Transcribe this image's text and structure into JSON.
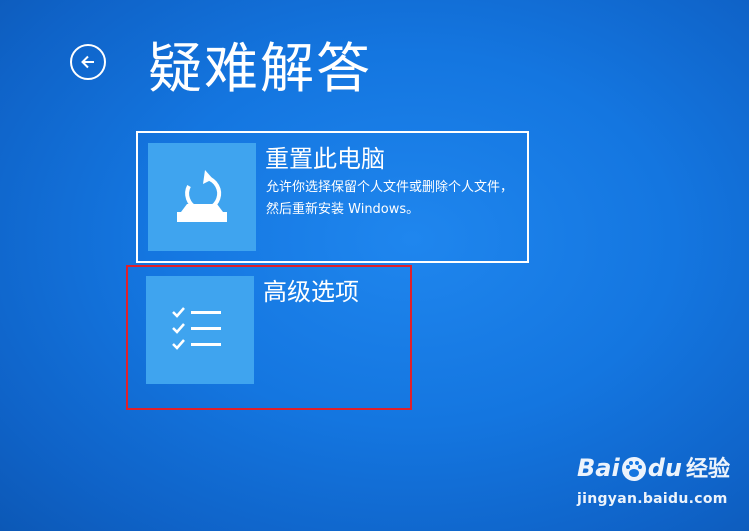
{
  "header": {
    "title": "疑难解答",
    "back_icon": "back-arrow-icon"
  },
  "options": [
    {
      "title": "重置此电脑",
      "description": "允许你选择保留个人文件或删除个人文件，然后重新安装 Windows。",
      "icon": "reset-pc-icon",
      "selected": true
    },
    {
      "title": "高级选项",
      "description": "",
      "icon": "checklist-icon",
      "highlighted": true
    }
  ],
  "watermark": {
    "brand_a": "Bai",
    "brand_b": "du",
    "product": "经验",
    "url": "jingyan.baidu.com"
  },
  "colors": {
    "background": "#1476e0",
    "tile": "#3fa4ef",
    "highlight_border": "#e0202a"
  }
}
